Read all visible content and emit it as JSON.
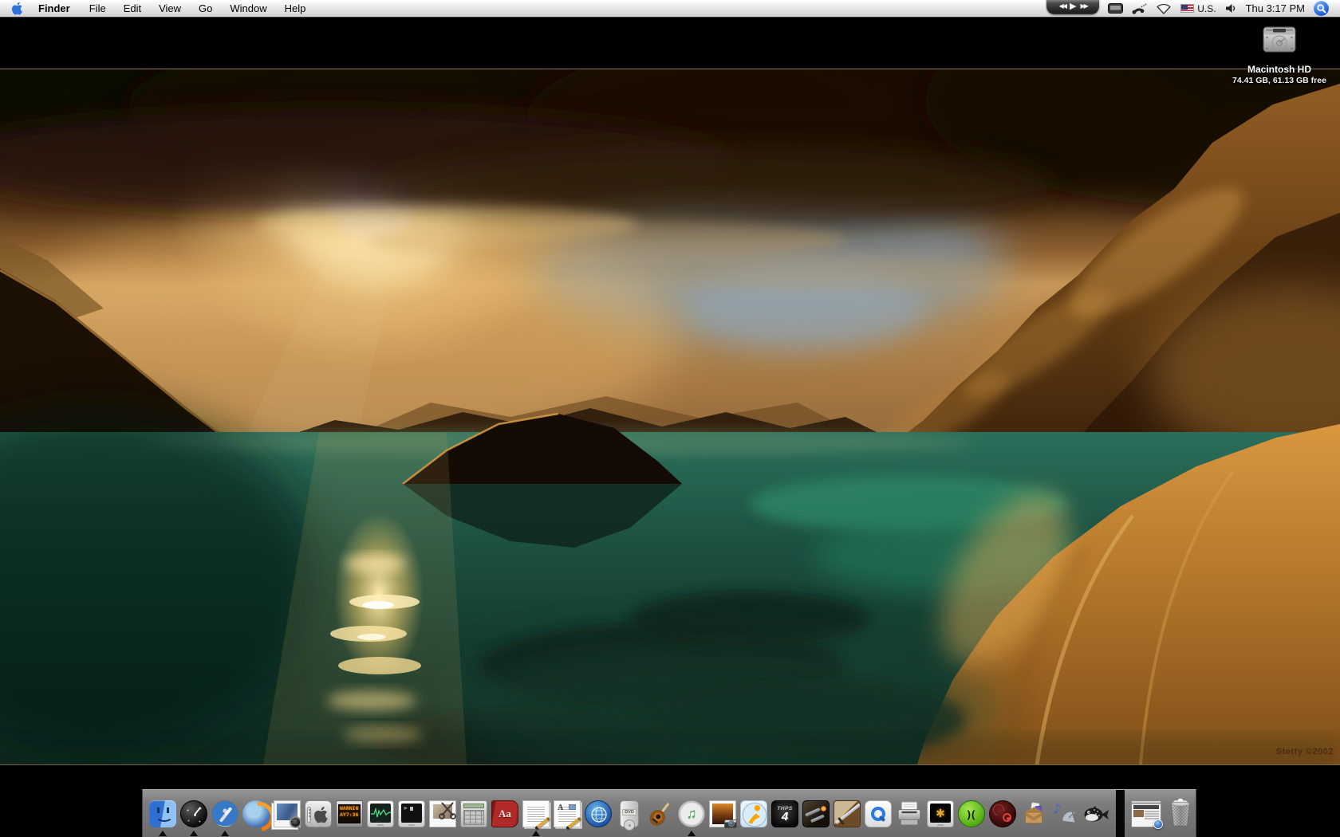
{
  "menu_bar": {
    "app_menu": "Finder",
    "menus": [
      "File",
      "Edit",
      "View",
      "Go",
      "Window",
      "Help"
    ],
    "status": {
      "itunes_controls": {
        "previous": "◀◀",
        "play": "▶",
        "next": "▶▶"
      },
      "input_source": "U.S.",
      "clock": "Thu 3:17 PM"
    }
  },
  "desktop": {
    "volume_icon": {
      "label": "Macintosh HD",
      "info": "74.41 GB, 61.13 GB free"
    },
    "watermark": "Stetty ©2002"
  },
  "dock": {
    "apps": [
      {
        "name": "finder",
        "running": true
      },
      {
        "name": "dashboard",
        "running": true
      },
      {
        "name": "safari",
        "running": true
      },
      {
        "name": "firefox",
        "running": false
      },
      {
        "name": "iphoto",
        "running": false
      },
      {
        "name": "front-row",
        "running": false
      },
      {
        "name": "led-sign",
        "running": false
      },
      {
        "name": "activity-monitor",
        "running": false
      },
      {
        "name": "terminal",
        "running": false
      },
      {
        "name": "grab",
        "running": false
      },
      {
        "name": "calculator",
        "running": false
      },
      {
        "name": "dictionary",
        "running": false
      },
      {
        "name": "textedit",
        "running": true
      },
      {
        "name": "pages",
        "running": false
      },
      {
        "name": "internet-connect",
        "running": false
      },
      {
        "name": "dvd-player",
        "running": false
      },
      {
        "name": "garageband",
        "running": false
      },
      {
        "name": "itunes",
        "running": true
      },
      {
        "name": "photo-camera-app",
        "running": false
      },
      {
        "name": "aim",
        "running": false
      },
      {
        "name": "thps4-game",
        "running": false
      },
      {
        "name": "shooter-game",
        "running": false
      },
      {
        "name": "sword-game",
        "running": false
      },
      {
        "name": "quicktime",
        "running": false
      },
      {
        "name": "printer-setup",
        "running": false
      },
      {
        "name": "gold-screen-game",
        "running": false
      },
      {
        "name": "green-sphere-app",
        "running": false
      },
      {
        "name": "red-target-app",
        "running": false
      },
      {
        "name": "installer-box-app",
        "running": false
      },
      {
        "name": "radio-satellite-app",
        "running": false
      },
      {
        "name": "fugu",
        "running": false
      }
    ],
    "icon_text": {
      "led_line1": "WARNIN",
      "led_line2": "AY7:36 A",
      "thps_brand": "THPS",
      "thps_number": "4",
      "dvd": "DVD",
      "dictionary": "Aa",
      "pages_letter": "A",
      "terminal_prompt": ">",
      "itunes_notes": "♫",
      "gold_emblem": "✱",
      "green_glyph": ")(",
      "note_glyph": "♪"
    },
    "minimized_window": "safari-page-thumbnail",
    "trash_state": "full"
  },
  "colors": {
    "spotlight_blue": "#2063dc",
    "dock_gray": "#7c7c7c",
    "menubar": "#ffffff",
    "desktop_background": "#000000",
    "apple_logo_blue": "#2f72d8"
  }
}
